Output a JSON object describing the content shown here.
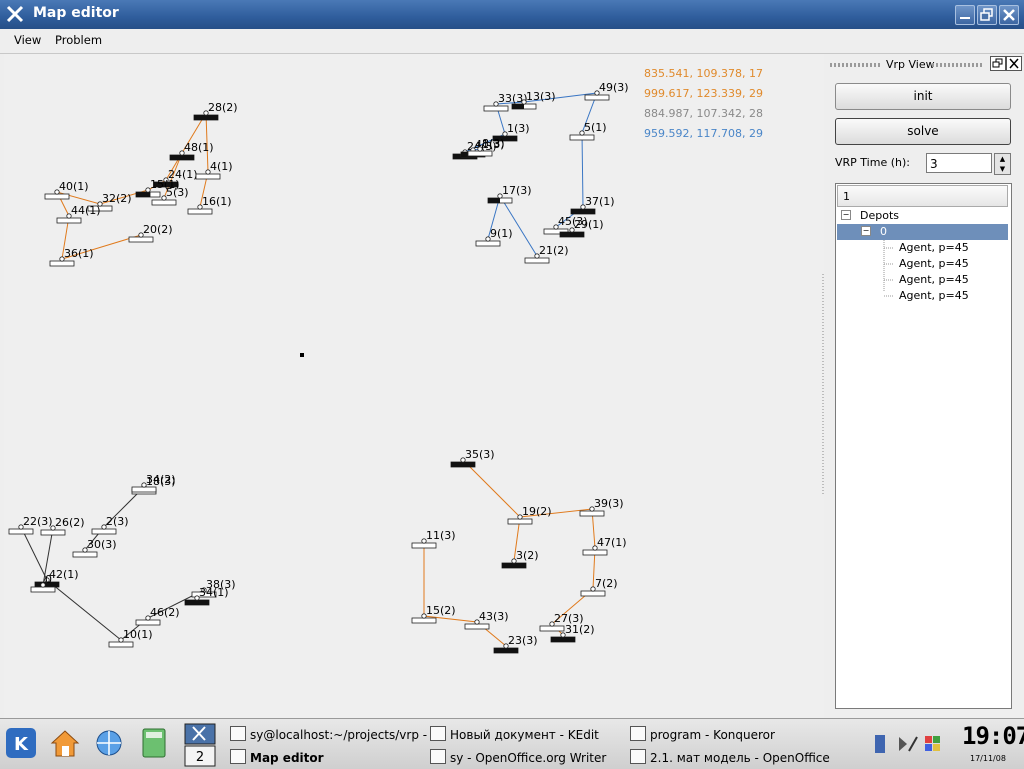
{
  "window": {
    "title": "Map editor"
  },
  "menu": {
    "items": [
      "View",
      "Problem"
    ]
  },
  "map": {
    "coord_readouts": [
      {
        "text": "835.541, 109.378, 17",
        "color": "#e08a2c"
      },
      {
        "text": "999.617, 123.339, 29",
        "color": "#e08a2c"
      },
      {
        "text": "884.987, 107.342, 28",
        "color": "#8a8a8a"
      },
      {
        "text": "959.592, 117.708, 29",
        "color": "#4a86c8"
      }
    ],
    "route_colors": {
      "orange": "#e07a1c",
      "blue": "#3a76c4",
      "black": "#333333"
    },
    "node_labels": [
      "28(2)",
      "48(1)",
      "24(1)",
      "4(1)",
      "15(1)",
      "5(3)",
      "16(1)",
      "40(1)",
      "32(2)",
      "44(1)",
      "20(2)",
      "36(1)",
      "33(3)",
      "13(3)",
      "49(3)",
      "1(3)",
      "5(1)",
      "24(3)",
      "41(3)",
      "8(3)",
      "17(3)",
      "37(1)",
      "45(3)",
      "29(1)",
      "9(1)",
      "21(2)",
      "18(3)",
      "34(2)",
      "22(3)",
      "26(2)",
      "2(3)",
      "30(3)",
      "42(1)",
      "0",
      "38(3)",
      "34(1)",
      "46(2)",
      "10(1)",
      "35(3)",
      "19(2)",
      "39(3)",
      "11(3)",
      "47(1)",
      "3(2)",
      "7(2)",
      "15(2)",
      "43(3)",
      "27(3)",
      "31(2)",
      "23(3)"
    ]
  },
  "vrp_panel": {
    "title": "Vrp View",
    "init_label": "init",
    "solve_label": "solve",
    "time_label": "VRP Time (h):",
    "time_value": "3",
    "tree": {
      "header": "1",
      "depots_label": "Depots",
      "depot_label": "0",
      "agents": [
        "Agent, p=45",
        "Agent, p=45",
        "Agent, p=45",
        "Agent, p=45"
      ]
    }
  },
  "taskbar": {
    "desktop_numbers": [
      "1",
      "2"
    ],
    "tasks": [
      {
        "label": "sy@localhost:~/projects/vrp -",
        "active": false
      },
      {
        "label": "Новый документ - KEdit",
        "active": false
      },
      {
        "label": "program - Konqueror",
        "active": false
      },
      {
        "label": "Map editor",
        "active": true
      },
      {
        "label": "sy - OpenOffice.org Writer",
        "active": false
      },
      {
        "label": "2.1. мат модель - OpenOffice",
        "active": false
      }
    ],
    "clock": "19:07",
    "date": "17/11/08"
  }
}
